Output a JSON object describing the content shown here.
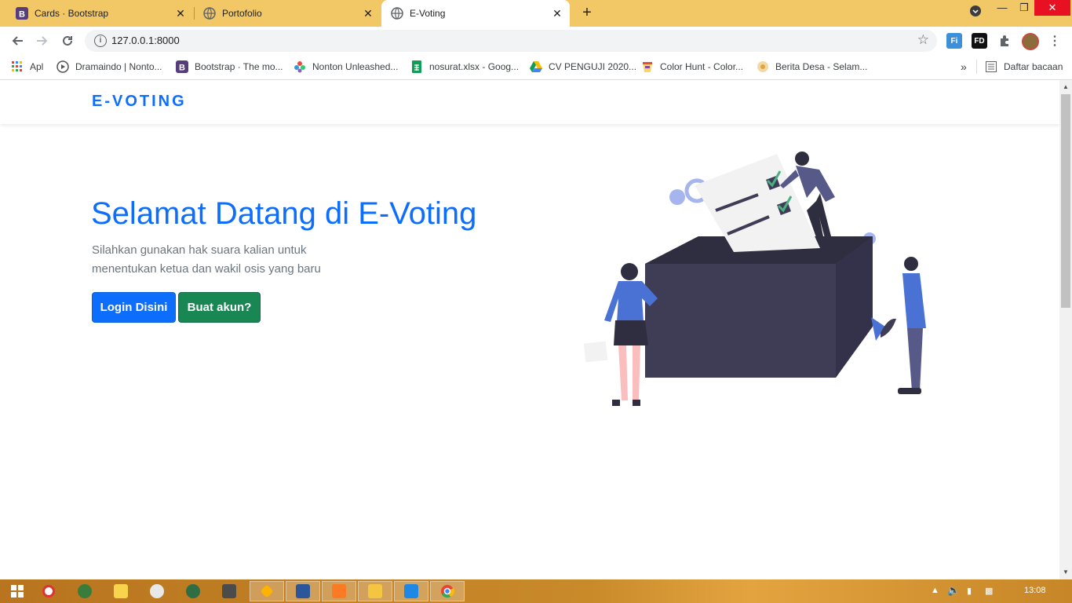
{
  "browser": {
    "tabs": [
      {
        "title": "Cards · Bootstrap",
        "icon": "bootstrap-icon",
        "active": false
      },
      {
        "title": "Portofolio",
        "icon": "globe-icon",
        "active": false
      },
      {
        "title": "E-Voting",
        "icon": "globe-icon",
        "active": true
      }
    ],
    "close_glyph": "✕",
    "new_tab_glyph": "+",
    "url": "127.0.0.1:8000",
    "extensions": [
      "Fi",
      "FD"
    ],
    "bookmarks": [
      {
        "label": "Apl",
        "icon": "apps-grid-icon"
      },
      {
        "label": "Dramaindo | Nonto...",
        "icon": "play-circle-icon"
      },
      {
        "label": "Bootstrap · The mo...",
        "icon": "bootstrap-icon"
      },
      {
        "label": "Nonton Unleashed...",
        "icon": "flower-icon"
      },
      {
        "label": "nosurat.xlsx - Goog...",
        "icon": "sheets-icon"
      },
      {
        "label": "CV PENGUJI 2020...",
        "icon": "drive-icon"
      },
      {
        "label": "Color Hunt - Color...",
        "icon": "colorhunt-icon"
      },
      {
        "label": "Berita Desa - Selam...",
        "icon": "news-icon"
      }
    ],
    "more_bookmarks_glyph": "»",
    "reading_list": "Daftar bacaan"
  },
  "page": {
    "brand": "E-VOTING",
    "hero_title": "Selamat Datang di E-Voting",
    "hero_text": "Silahkan gunakan hak suara kalian untuk menentukan ketua dan wakil osis yang baru",
    "login_button": "Login Disini",
    "register_button": "Buat akun?",
    "colors": {
      "primary": "#0d6efd",
      "success": "#198754",
      "muted": "#6c757d",
      "titlebar": "#f2c766"
    }
  },
  "taskbar": {
    "clock": "13:08",
    "apps": [
      "start-icon",
      "opera-icon",
      "globe-app-icon",
      "files-icon",
      "paint-icon",
      "browser-icon",
      "sublime-icon",
      "sketch-icon",
      "word-icon",
      "xampp-icon",
      "explorer-icon",
      "vscode-icon",
      "chrome-icon"
    ]
  }
}
